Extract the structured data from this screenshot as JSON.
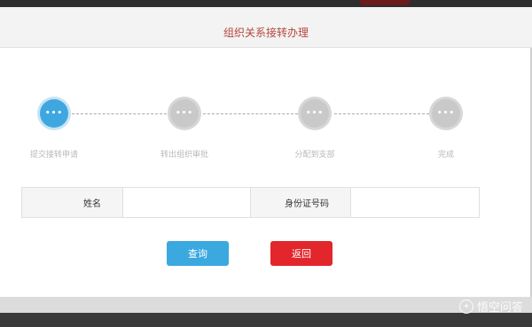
{
  "modal": {
    "title": "组织关系接转办理"
  },
  "steps": [
    {
      "label": "提交接转申请",
      "icon": "ellipsis-icon",
      "glyph": "•••",
      "active": true
    },
    {
      "label": "转出组织审批",
      "icon": "ellipsis-icon",
      "glyph": "•••",
      "active": false
    },
    {
      "label": "分配到支部",
      "icon": "ellipsis-icon",
      "glyph": "•••",
      "active": false
    },
    {
      "label": "完成",
      "icon": "ellipsis-icon",
      "glyph": "•••",
      "active": false
    }
  ],
  "form": {
    "name_label": "姓名",
    "name_value": "",
    "id_label": "身份证号码",
    "id_value": ""
  },
  "buttons": {
    "query_label": "查询",
    "back_label": "返回"
  },
  "watermark": {
    "text": "悟空问答"
  },
  "colors": {
    "title": "#b5473b",
    "active_step": "#3ea7e0",
    "inactive_step": "#c9c9c9",
    "query_button": "#3ba8e0",
    "back_button": "#e2262b"
  }
}
